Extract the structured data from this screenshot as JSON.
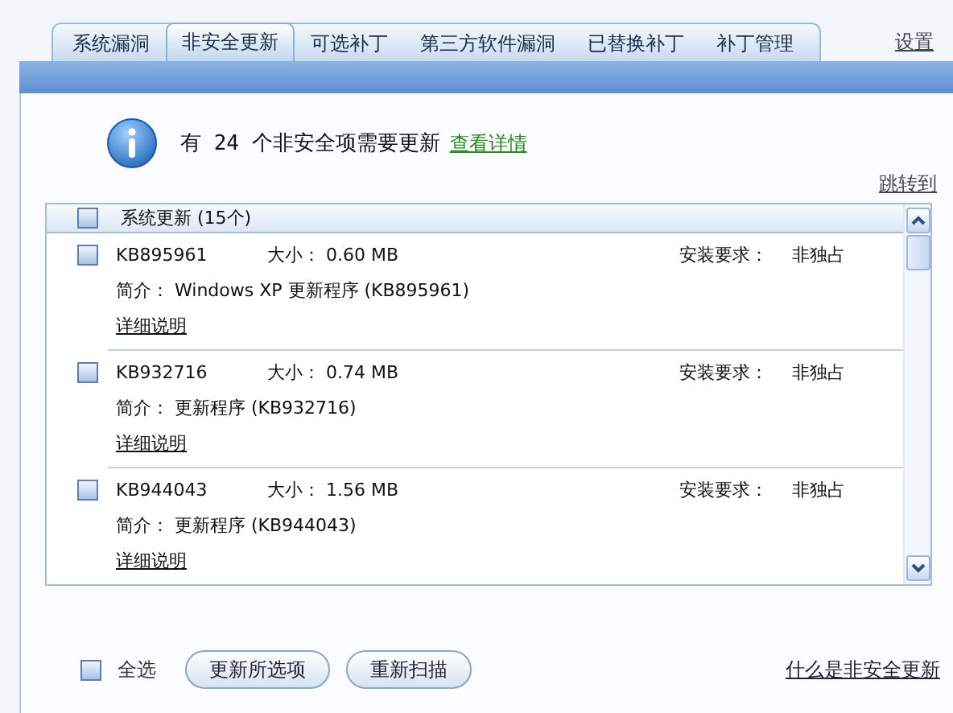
{
  "tabs": [
    {
      "label": "系统漏洞",
      "selected": false
    },
    {
      "label": "非安全更新",
      "selected": true
    },
    {
      "label": "可选补丁",
      "selected": false
    },
    {
      "label": "第三方软件漏洞",
      "selected": false
    },
    {
      "label": "已替换补丁",
      "selected": false
    },
    {
      "label": "补丁管理",
      "selected": false
    }
  ],
  "settings_link": "设置",
  "summary": {
    "prefix": "有",
    "count": "24",
    "suffix": "个非安全项需要更新",
    "link": "查看详情"
  },
  "jump_link": "跳转到",
  "group": {
    "label": "系统更新 (15个)",
    "checked": false
  },
  "updates": [
    {
      "id": "KB895961",
      "size": "大小： 0.60 MB",
      "requirement_label": "安装要求：",
      "requirement": "非独占",
      "description": "简介： Windows XP 更新程序 (KB895961)",
      "details": "详细说明",
      "checked": false
    },
    {
      "id": "KB932716",
      "size": "大小： 0.74 MB",
      "requirement_label": "安装要求：",
      "requirement": "非独占",
      "description": "简介： 更新程序 (KB932716)",
      "details": "详细说明",
      "checked": false
    },
    {
      "id": "KB944043",
      "size": "大小： 1.56 MB",
      "requirement_label": "安装要求：",
      "requirement": "非独占",
      "description": "简介： 更新程序 (KB944043)",
      "details": "详细说明",
      "checked": false
    }
  ],
  "select_all": {
    "label": "全选",
    "checked": false
  },
  "buttons": [
    "更新所选项",
    "重新扫描"
  ],
  "help_link": "什么是非安全更新"
}
